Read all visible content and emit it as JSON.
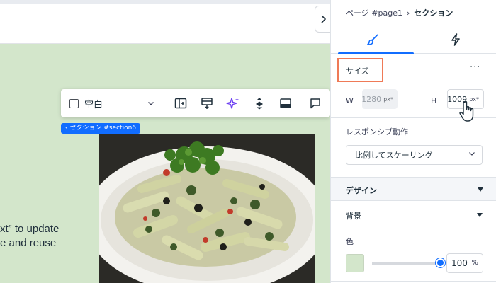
{
  "canvas": {
    "section_tag": "‹ セクション #section6",
    "body_text": [
      "xt” to update",
      "e and reuse"
    ],
    "section_color": "#d3e6cb"
  },
  "toolbar": {
    "dropdown_label": "空白",
    "buttons": [
      "layout-icon",
      "add-section-icon",
      "ai-sparkle-icon",
      "arrange-icon",
      "background-icon",
      "comment-icon"
    ]
  },
  "panel": {
    "breadcrumb": {
      "parent": "ページ #page1",
      "separator": "›",
      "current": "セクション"
    },
    "tabs": [
      {
        "name": "design",
        "icon": "paintbrush-icon",
        "active": true
      },
      {
        "name": "interactions",
        "icon": "lightning-icon",
        "active": false
      }
    ],
    "size": {
      "title": "サイズ",
      "more": "···",
      "w_label": "W",
      "w_value": "1280",
      "w_unit": "px*",
      "h_label": "H",
      "h_value": "1009",
      "h_unit": "px*"
    },
    "responsive": {
      "title": "レスポンシブ動作",
      "selected": "比例してスケーリング"
    },
    "design": {
      "title": "デザイン"
    },
    "background": {
      "title": "背景",
      "color_label": "色",
      "color": "#d3e6cb",
      "opacity": "100",
      "opacity_unit": "%"
    },
    "accent": "#116dff",
    "highlight": "#ef7a57"
  }
}
